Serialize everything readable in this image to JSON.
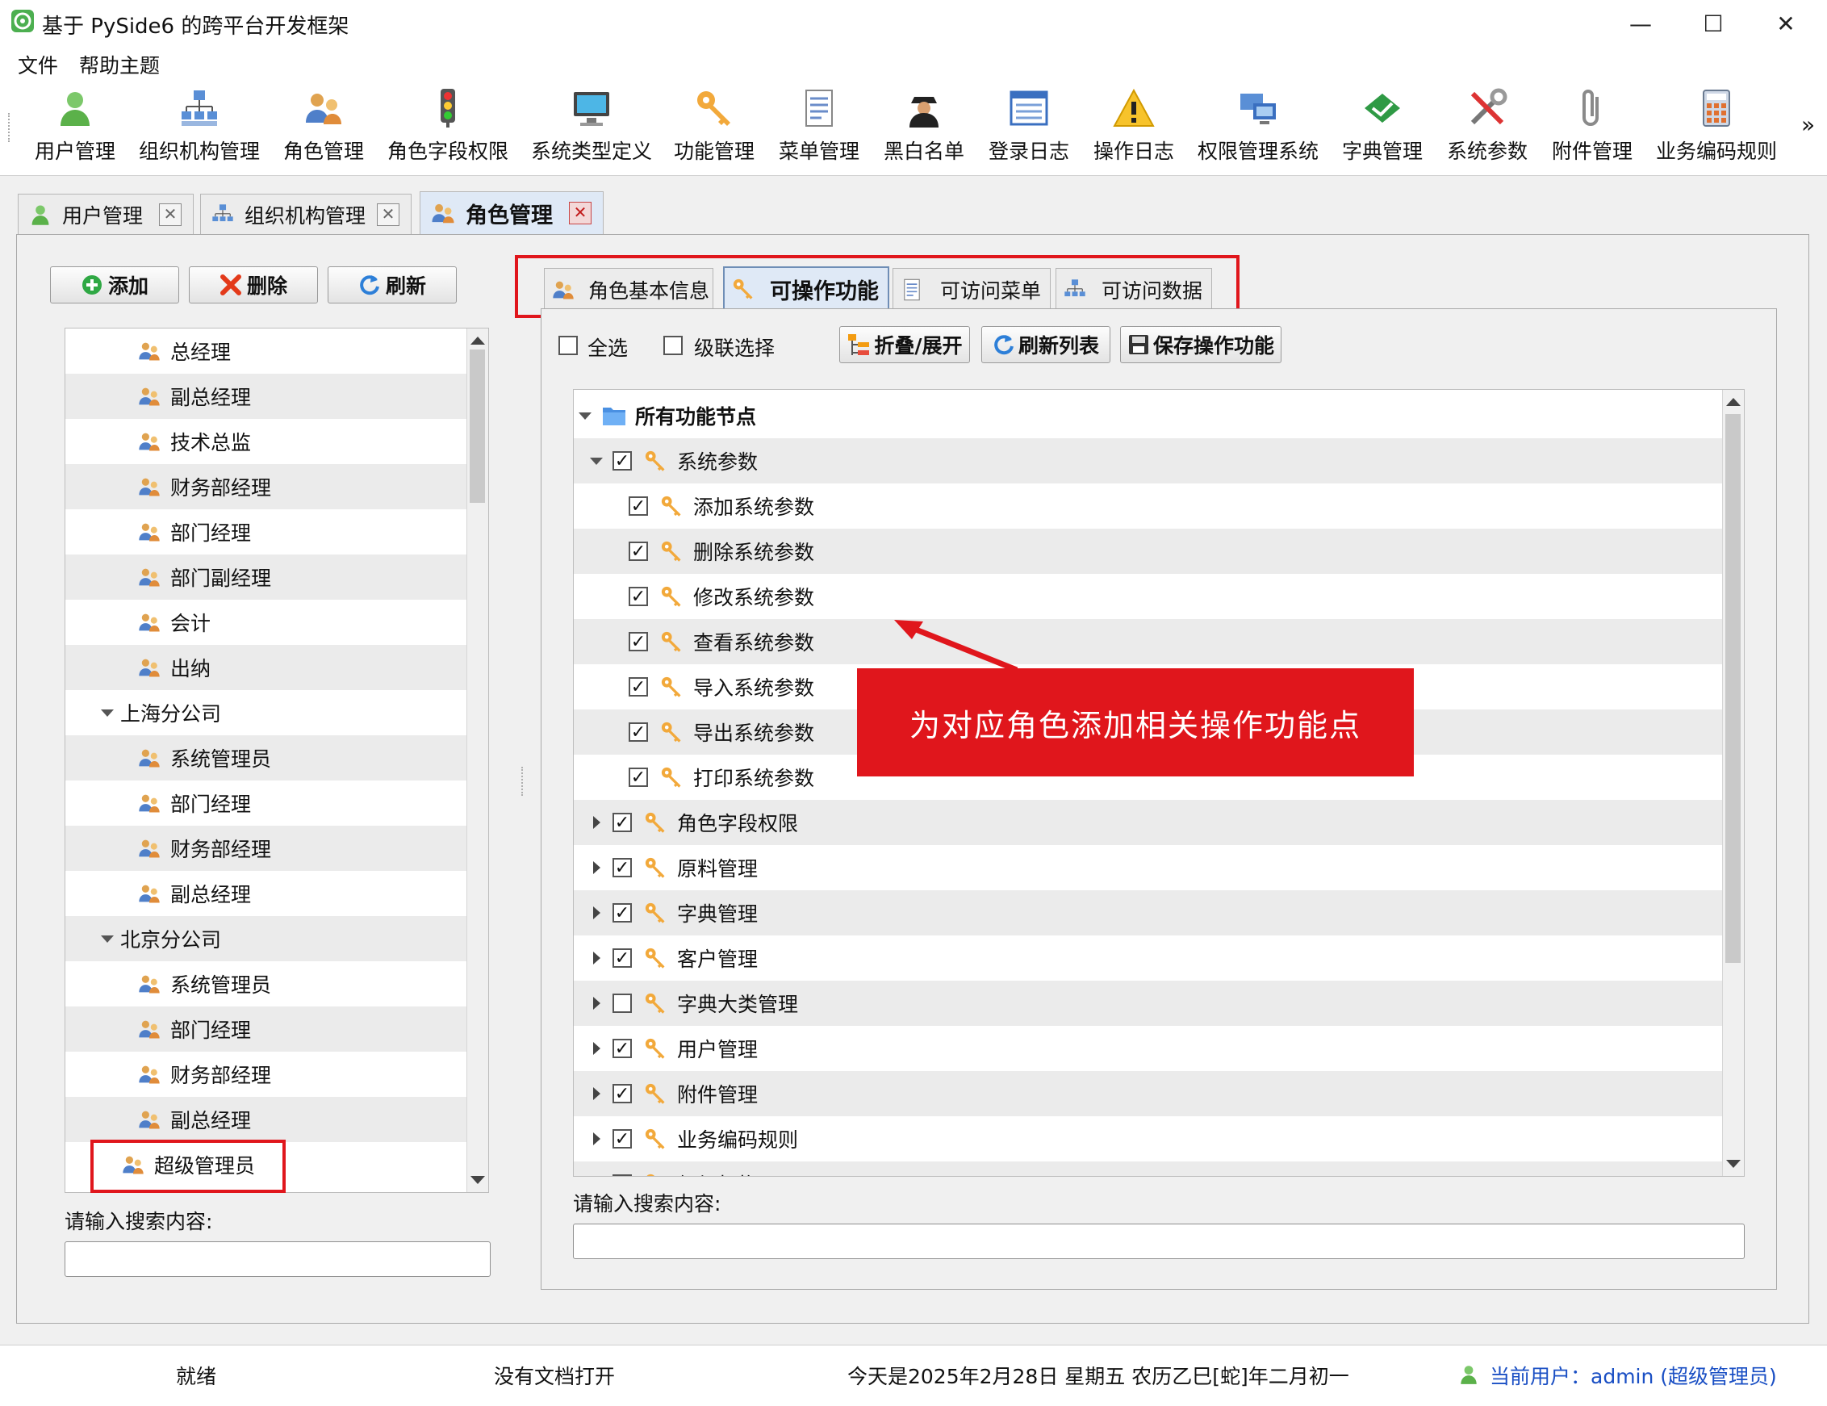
{
  "window": {
    "title": "基于 PySide6 的跨平台开发框架",
    "controls": {
      "minimize": "—",
      "maximize": "☐",
      "close": "✕"
    }
  },
  "menu": [
    "文件",
    "帮助主题"
  ],
  "toolbar": {
    "items": [
      {
        "label": "用户管理",
        "icon": "user-icon"
      },
      {
        "label": "组织机构管理",
        "icon": "org-chart-icon"
      },
      {
        "label": "角色管理",
        "icon": "roles-icon"
      },
      {
        "label": "角色字段权限",
        "icon": "traffic-light-icon"
      },
      {
        "label": "系统类型定义",
        "icon": "monitor-icon"
      },
      {
        "label": "功能管理",
        "icon": "key-icon"
      },
      {
        "label": "菜单管理",
        "icon": "menu-doc-icon"
      },
      {
        "label": "黑白名单",
        "icon": "spy-icon"
      },
      {
        "label": "登录日志",
        "icon": "log-list-icon"
      },
      {
        "label": "操作日志",
        "icon": "warning-icon"
      },
      {
        "label": "权限管理系统",
        "icon": "computers-icon"
      },
      {
        "label": "字典管理",
        "icon": "book-icon"
      },
      {
        "label": "系统参数",
        "icon": "tools-icon"
      },
      {
        "label": "附件管理",
        "icon": "paperclip-icon"
      },
      {
        "label": "业务编码规则",
        "icon": "calculator-icon"
      }
    ],
    "overflow": "»"
  },
  "doc_tabs": [
    {
      "label": "用户管理",
      "active": false
    },
    {
      "label": "组织机构管理",
      "active": false
    },
    {
      "label": "角色管理",
      "active": true
    }
  ],
  "left": {
    "buttons": {
      "add": "添加",
      "delete": "删除",
      "refresh": "刷新"
    },
    "tree": [
      {
        "label": "总经理",
        "level": 2
      },
      {
        "label": "副总经理",
        "level": 2
      },
      {
        "label": "技术总监",
        "level": 2
      },
      {
        "label": "财务部经理",
        "level": 2
      },
      {
        "label": "部门经理",
        "level": 2
      },
      {
        "label": "部门副经理",
        "level": 2
      },
      {
        "label": "会计",
        "level": 2
      },
      {
        "label": "出纳",
        "level": 2
      },
      {
        "label": "上海分公司",
        "level": 1
      },
      {
        "label": "系统管理员",
        "level": 2
      },
      {
        "label": "部门经理",
        "level": 2
      },
      {
        "label": "财务部经理",
        "level": 2
      },
      {
        "label": "副总经理",
        "level": 2
      },
      {
        "label": "北京分公司",
        "level": 1
      },
      {
        "label": "系统管理员",
        "level": 2
      },
      {
        "label": "部门经理",
        "level": 2
      },
      {
        "label": "财务部经理",
        "level": 2
      },
      {
        "label": "副总经理",
        "level": 2
      },
      {
        "label": "超级管理员",
        "level": 1.5
      }
    ],
    "search_label": "请输入搜索内容:",
    "search_value": ""
  },
  "sub_tabs": [
    "角色基本信息",
    "可操作功能",
    "可访问菜单",
    "可访问数据"
  ],
  "func": {
    "select_all": "全选",
    "cascade": "级联选择",
    "buttons": {
      "toggle": "折叠/展开",
      "refresh": "刷新列表",
      "save": "保存操作功能"
    },
    "root": "所有功能节点",
    "nodes": [
      {
        "label": "系统参数",
        "level": 1,
        "checked": true,
        "expanded": true
      },
      {
        "label": "添加系统参数",
        "level": 2,
        "checked": true
      },
      {
        "label": "删除系统参数",
        "level": 2,
        "checked": true
      },
      {
        "label": "修改系统参数",
        "level": 2,
        "checked": true
      },
      {
        "label": "查看系统参数",
        "level": 2,
        "checked": true
      },
      {
        "label": "导入系统参数",
        "level": 2,
        "checked": true
      },
      {
        "label": "导出系统参数",
        "level": 2,
        "checked": true
      },
      {
        "label": "打印系统参数",
        "level": 2,
        "checked": true
      },
      {
        "label": "角色字段权限",
        "level": 1,
        "checked": true
      },
      {
        "label": "原料管理",
        "level": 1,
        "checked": true
      },
      {
        "label": "字典管理",
        "level": 1,
        "checked": true
      },
      {
        "label": "客户管理",
        "level": 1,
        "checked": true
      },
      {
        "label": "字典大类管理",
        "level": 1,
        "checked": false
      },
      {
        "label": "用户管理",
        "level": 1,
        "checked": true
      },
      {
        "label": "附件管理",
        "level": 1,
        "checked": true
      },
      {
        "label": "业务编码规则",
        "level": 1,
        "checked": true
      },
      {
        "label": "组织机构",
        "level": 1,
        "checked": true
      }
    ],
    "search_label": "请输入搜索内容:",
    "search_value": ""
  },
  "annotation": "为对应角色添加相关操作功能点",
  "status": {
    "ready": "就绪",
    "doc": "没有文档打开",
    "date": "今天是2025年2月28日 星期五 农历乙巳[蛇]年二月初一",
    "user": "当前用户：admin (超级管理员)"
  },
  "colors": {
    "accent_red": "#e0161c",
    "active_tab": "#dfe9f6",
    "user_link": "#1a4fc4",
    "check_green": "#2a9d3b"
  }
}
